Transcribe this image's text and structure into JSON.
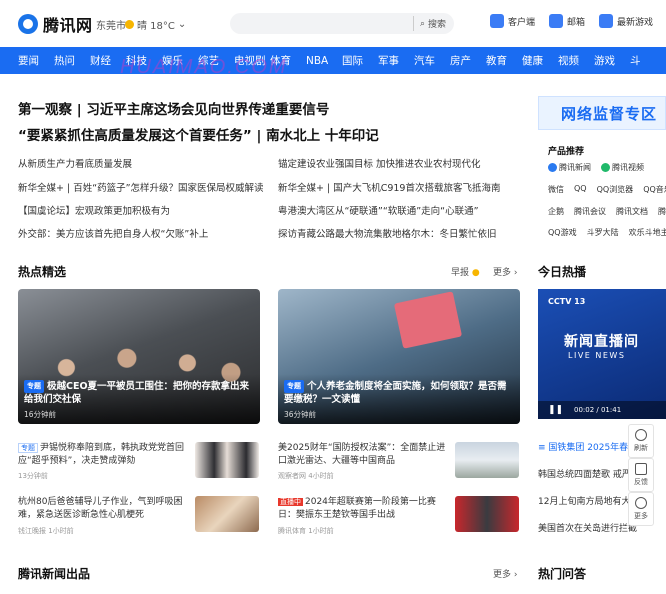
{
  "header": {
    "logo_text": "腾讯网",
    "city": "东莞市",
    "weather": "晴 18°C",
    "search_label": "搜索",
    "links": [
      {
        "icon": "phone-icon",
        "label": "客户端"
      },
      {
        "icon": "mail-icon",
        "label": "邮箱"
      },
      {
        "icon": "gamepad-icon",
        "label": "最新游戏"
      }
    ]
  },
  "nav": [
    "要闻",
    "热问",
    "财经",
    "科技",
    "娱乐",
    "综艺",
    "电视剧",
    "体育",
    "NBA",
    "国际",
    "军事",
    "汽车",
    "房产",
    "教育",
    "健康",
    "视频",
    "游戏",
    "斗"
  ],
  "watermark": "HUAIMAO.COM",
  "headlines": {
    "h1": "第一观察 | 习近平主席这场会见向世界传递重要信号",
    "h2": "“要紧紧抓住高质量发展这个首要任务” | 南水北上 十年印记",
    "left": [
      "从新质生产力看底质量发展",
      "新华全媒+ | 百姓“药篮子”怎样升级？国家医保局权威解读",
      "【国虞论坛】宏观政策更加积极有为",
      "外交部：美方应该首先把自身人权“欠账”补上"
    ],
    "right": [
      "锚定建设农业强国目标 加快推进农业农村现代化",
      "新华全媒+ | 国产大飞机C919首次搭载旅客飞抵海南",
      "粤港澳大湾区从“硬联通”“软联通”走向“心联通”",
      "探访青藏公路最大物流集散地格尔木：冬日繁忙依旧"
    ]
  },
  "sidebar": {
    "banner": "网络监督专区",
    "products_title": "产品推荐",
    "rows": [
      [
        "腾讯新闻",
        "腾讯视频"
      ],
      [
        "微信",
        "QQ",
        "QQ浏览器",
        "QQ音乐"
      ],
      [
        "企鹅",
        "腾讯会议",
        "腾讯文档",
        "腾讯手"
      ],
      [
        "QQ游戏",
        "斗罗大陆",
        "欢乐斗地主"
      ]
    ],
    "today_hot": "今日热播",
    "video": {
      "channel": "CCTV 13",
      "title": "新闻直播间",
      "subtitle": "LIVE NEWS",
      "time": "00:02 / 01:41"
    },
    "list": [
      "国铁集团 2025年春运",
      "韩国总统四面楚歌 戒严",
      "12月上旬南方局地有大雪",
      "美国首次在关岛进行拦截"
    ],
    "hot_qa": "热门问答"
  },
  "sections": {
    "hot_picks": "热点精选",
    "early": "早报",
    "more": "更多",
    "tencent_news": "腾讯新闻出品"
  },
  "cards": [
    {
      "tag": "专题",
      "title": "极越CEO夏一平被员工围住：把你的存款拿出来给我们交社保",
      "meta": "16分钟前"
    },
    {
      "tag": "专题",
      "title": "个人养老金制度将全面实施，如何领取？是否需要缴税？一文读懂",
      "meta": "36分钟前"
    }
  ],
  "items": [
    {
      "badge": "专题",
      "text": "尹锡悦称奉陪到底，韩执政党党首回应“超乎预料”，决走赞成弹劾",
      "meta": "13分钟前"
    },
    {
      "badge": "",
      "text": "美2025财年“国防授权法案”：全面禁止进口激光雷达、大疆等中国商品",
      "meta": "观察者网 4小时前"
    },
    {
      "badge": "",
      "text": "杭州80后爸爸辅导儿子作业，气到呼吸困难，紧急送医诊断急性心肌梗死",
      "meta": "钱江晚报 1小时前"
    },
    {
      "badge": "直播中",
      "text": "2024年超联赛第一阶段第一比赛日：樊振东王楚钦等国手出战",
      "meta": "腾讯体育 1小时前"
    }
  ],
  "float": [
    {
      "icon": "refresh-icon",
      "label": "刷新"
    },
    {
      "icon": "feedback-icon",
      "label": "反馈"
    },
    {
      "icon": "more-icon",
      "label": "更多"
    }
  ]
}
